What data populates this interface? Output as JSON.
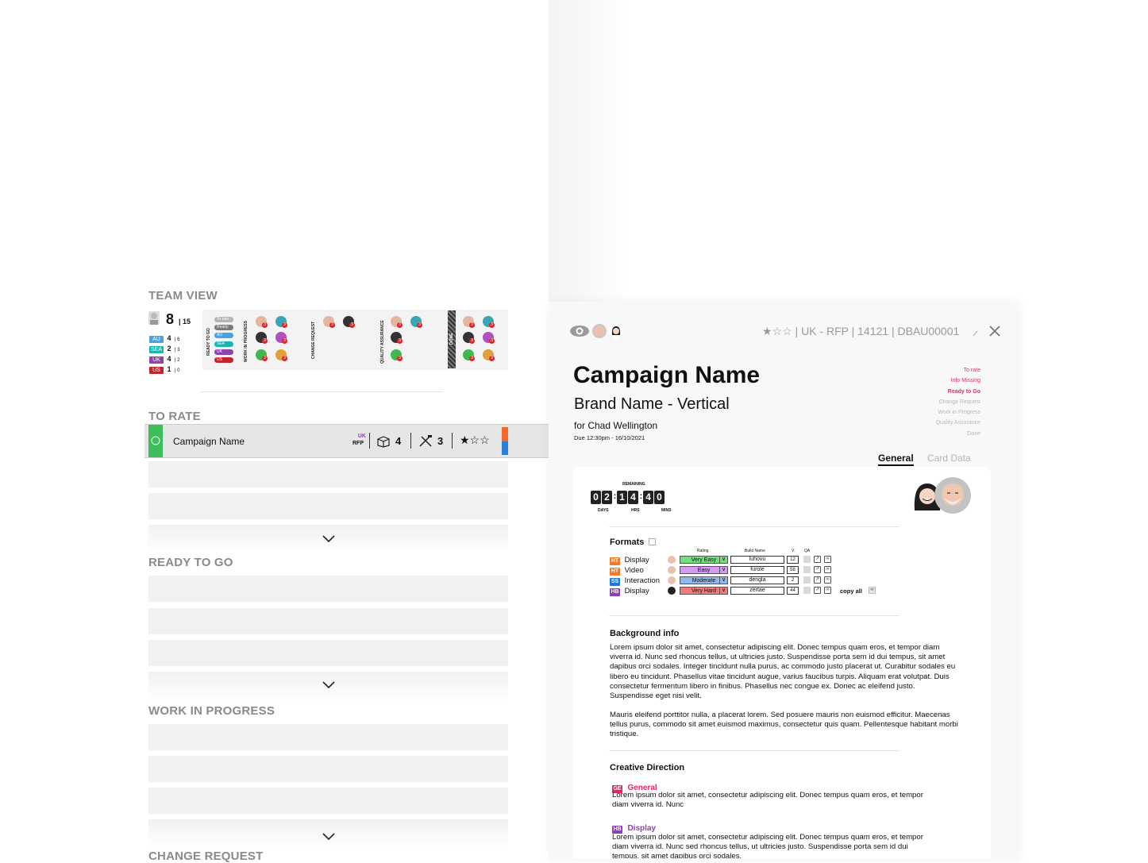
{
  "team_view": {
    "title": "TEAM VIEW",
    "total": "8",
    "total_sub": "| 15",
    "regions": [
      {
        "code": "AU",
        "count": "4",
        "sub": "| 6",
        "color": "#4aa3df"
      },
      {
        "code": "SEA",
        "count": "2",
        "sub": "| 3",
        "color": "#1bb5b0"
      },
      {
        "code": "UK",
        "count": "4",
        "sub": "| 2",
        "color": "#8e44ad"
      },
      {
        "code": "US",
        "count": "1",
        "sub": "| 0",
        "color": "#c0262d"
      }
    ],
    "columns": [
      "READY TO GO",
      "WORK IN PROGRESS",
      "CHANGE REQUEST",
      "QUALITY ASSURANCE",
      "DONE"
    ],
    "status_pills": [
      {
        "label": "To rate",
        "color": "#b5b5b5"
      },
      {
        "label": "Ready",
        "color": "#7a7a7a"
      },
      {
        "label": "AU",
        "color": "#4aa3df"
      },
      {
        "label": "SEA",
        "color": "#1bb5b0"
      },
      {
        "label": "UK",
        "color": "#8e44ad"
      },
      {
        "label": "US",
        "color": "#c0262d"
      }
    ],
    "badge_count": "3"
  },
  "sections": {
    "to_rate": "TO RATE",
    "ready_to_go": "READY TO GO",
    "work_in_progress": "WORK IN PROGRESS",
    "change_request": "CHANGE REQUEST"
  },
  "to_rate_card": {
    "name": "Campaign Name",
    "region": "UK",
    "type": "RFP",
    "boxes": "4",
    "tools": "3",
    "stars": "★☆☆"
  },
  "panel": {
    "meta": "★☆☆ | UK - RFP | 14121 | DBAU00001",
    "title": "Campaign Name",
    "subtitle": "Brand Name - Vertical",
    "for_line": "for Chad Wellington",
    "due": "Due 12:30pm - 16/10/2021",
    "statuses": [
      {
        "label": "To rate",
        "color": "#d6336c",
        "bold": false
      },
      {
        "label": "Info Missing",
        "color": "#d6336c",
        "bold": false
      },
      {
        "label": "Ready to Go",
        "color": "#d6336c",
        "bold": true
      },
      {
        "label": "Change Request",
        "color": "#b9b9b9",
        "bold": false
      },
      {
        "label": "Work in Progress",
        "color": "#b9b9b9",
        "bold": false
      },
      {
        "label": "Quality Assurance",
        "color": "#b9b9b9",
        "bold": false
      },
      {
        "label": "Done",
        "color": "#b9b9b9",
        "bold": false
      }
    ],
    "tabs": {
      "general": "General",
      "card_data": "Card Data"
    },
    "countdown": {
      "label": "REMAINING",
      "days": [
        "0",
        "2"
      ],
      "hrs": [
        "1",
        "4"
      ],
      "mins": [
        "4",
        "0"
      ],
      "days_label": "DAYS",
      "hrs_label": "HRS",
      "mins_label": "MINS"
    },
    "formats": {
      "title": "Formats",
      "headers": {
        "rating": "Rating",
        "build": "Build Name",
        "ver": "V.",
        "qa": "QA"
      },
      "rows": [
        {
          "tag": "HT",
          "tag_color": "#f07a2a",
          "name": "Display",
          "rating": "Very Easy",
          "rating_color": "#6fe07a",
          "build": "luhovu",
          "ver": "12"
        },
        {
          "tag": "HT",
          "tag_color": "#f07a2a",
          "name": "Video",
          "rating": "Easy",
          "rating_color": "#d59af2",
          "build": "furole",
          "ver": "58"
        },
        {
          "tag": "SS",
          "tag_color": "#2079d6",
          "name": "Interaction",
          "rating": "Moderate",
          "rating_color": "#8db8f0",
          "build": "dengla",
          "ver": "2"
        },
        {
          "tag": "HB",
          "tag_color": "#8e3fb5",
          "name": "Display",
          "rating": "Very Hard",
          "rating_color": "#f07b7b",
          "build": "zertae",
          "ver": "44"
        }
      ],
      "copy_all": "copy all"
    },
    "background": {
      "title": "Background info",
      "p1": "Lorem ipsum dolor sit amet, consectetur adipiscing elit. Donec tempus quam eros, et tempor diam viverra id. Nunc sed rhoncus tellus, ut ultricies justo. Suspendisse porta sem id dui tempus, sit amet dapibus orci sodales. Integer tincidunt nulla purus, ac commodo justo placerat ut. Curabitur sodales eu libero eu tincidunt. Phasellus vitae tincidunt augue, varius faucibus turpis. Aliquam erat volutpat. Duis consectetur fermentum libero in finibus. Phasellus nec congue ex. Donec ac eleifend justo. Suspendisse eget nisi velit.",
      "p2": "Mauris eleifend porttitor nulla, a placerat lorem. Sed posuere mauris non euismod efficitur. Maecenas tellus purus, commodo sit amet euismod maximus, consectetur quis quam. Pellentesque habitant morbi tristique."
    },
    "creative": {
      "title": "Creative Direction",
      "general_tag": "GE",
      "general_label": "General",
      "general_text": "Lorem ipsum dolor sit amet, consectetur adipiscing elit. Donec tempus quam eros, et tempor diam viverra id. Nunc",
      "display_tag": "HB",
      "display_label": "Display",
      "display_text": "Lorem ipsum dolor sit amet, consectetur adipiscing elit. Donec tempus quam eros, et tempor diam viverra id. Nunc sed rhoncus tellus, ut ultricies justo. Suspendisse porta sem id dui tempus, sit amet dapibus orci sodales."
    }
  }
}
